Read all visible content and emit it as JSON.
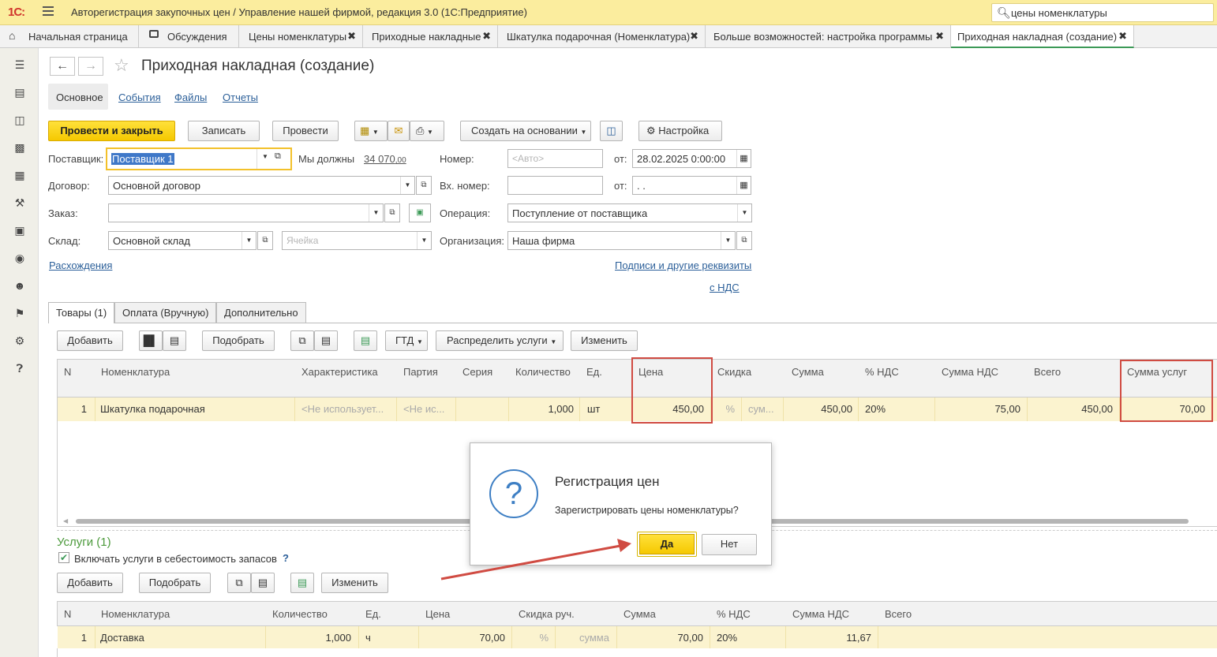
{
  "app": {
    "logo": "1С:",
    "title": "Авторегистрация закупочных цен / Управление нашей фирмой, редакция 3.0  (1С:Предприятие)",
    "search_value": "цены номенклатуры"
  },
  "tabs": [
    {
      "label": "Начальная страница"
    },
    {
      "label": "Обсуждения"
    },
    {
      "label": "Цены номенклатуры"
    },
    {
      "label": "Приходные накладные"
    },
    {
      "label": "Шкатулка подарочная (Номенклатура)"
    },
    {
      "label": "Больше возможностей: настройка программы"
    },
    {
      "label": "Приходная накладная (создание)"
    }
  ],
  "doc": {
    "title": "Приходная накладная (создание)",
    "sections": [
      "Основное",
      "События",
      "Файлы",
      "Отчеты"
    ]
  },
  "toolbar": {
    "post_close": "Провести и закрыть",
    "save": "Записать",
    "post": "Провести",
    "create_based": "Создать на основании",
    "settings": "Настройка"
  },
  "form": {
    "supplier_label": "Поставщик:",
    "supplier_value": "Поставщик 1",
    "we_owe_label": "Мы должны",
    "we_owe_value": "34 070",
    "we_owe_cents": ",00",
    "number_label": "Номер:",
    "number_placeholder": "<Авто>",
    "from_label": "от:",
    "date_value": "28.02.2025  0:00:00",
    "contract_label": "Договор:",
    "contract_value": "Основной договор",
    "in_number_label": "Вх. номер:",
    "from2_label": "от:",
    "date2_value": " .  .",
    "order_label": "Заказ:",
    "operation_label": "Операция:",
    "operation_value": "Поступление от поставщика",
    "warehouse_label": "Склад:",
    "warehouse_value": "Основной склад",
    "cell_placeholder": "Ячейка",
    "org_label": "Организация:",
    "org_value": "Наша фирма",
    "discrepancies_link": "Расхождения",
    "signatures_link": "Подписи и другие реквизиты",
    "vat_link": "с НДС"
  },
  "subtabs": [
    "Товары (1)",
    "Оплата (Вручную)",
    "Дополнительно"
  ],
  "goods_toolbar": {
    "add": "Добавить",
    "pick": "Подобрать",
    "gtd": "ГТД",
    "distribute": "Распределить услуги",
    "change": "Изменить"
  },
  "goods_table": {
    "headers": [
      "N",
      "Номенклатура",
      "Характеристика",
      "Партия",
      "Серия",
      "Количество",
      "Ед.",
      "Цена",
      "Скидка",
      "Сумма",
      "% НДС",
      "Сумма НДС",
      "Всего",
      "Сумма услуг"
    ],
    "rows": [
      {
        "n": "1",
        "item": "Шкатулка подарочная",
        "characteristic": "<Не использует...",
        "batch": "<Не ис...",
        "series": "",
        "qty": "1,000",
        "unit": "шт",
        "price": "450,00",
        "discount_pct": "%",
        "discount_sum": "сум...",
        "sum": "450,00",
        "vat_rate": "20%",
        "vat_sum": "75,00",
        "total": "450,00",
        "services_sum": "70,00"
      }
    ]
  },
  "services": {
    "title": "Услуги (1)",
    "include_label": "Включать услуги в себестоимость запасов",
    "help": "?",
    "add": "Добавить",
    "pick": "Подобрать",
    "change": "Изменить",
    "headers": [
      "N",
      "Номенклатура",
      "Количество",
      "Ед.",
      "Цена",
      "Скидка руч.",
      "Сумма",
      "% НДС",
      "Сумма НДС",
      "Всего"
    ],
    "rows": [
      {
        "n": "1",
        "item": "Доставка",
        "qty": "1,000",
        "unit": "ч",
        "price": "70,00",
        "discount_pct": "%",
        "discount_sum": "сумма",
        "sum": "70,00",
        "vat_rate": "20%",
        "vat_sum": "11,67",
        "total": ""
      }
    ]
  },
  "dialog": {
    "title": "Регистрация цен",
    "message": "Зарегистрировать цены номенклатуры?",
    "yes": "Да",
    "no": "Нет"
  },
  "colors": {
    "accent_yellow": "#f5c800",
    "highlight_red": "#d04b42",
    "row_yellow": "#fbf3cf",
    "link_blue": "#2b5f99"
  }
}
